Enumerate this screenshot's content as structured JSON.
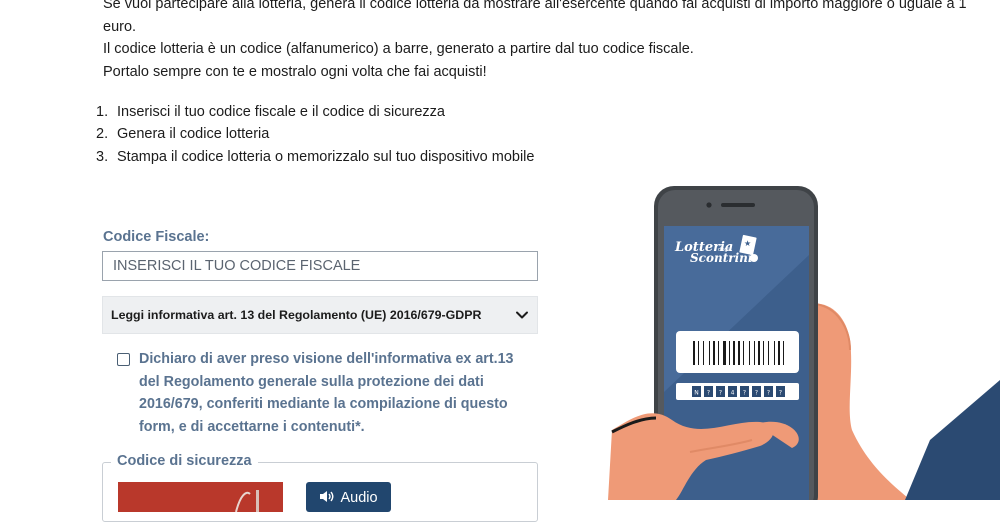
{
  "intro": {
    "line1": "Se vuoi partecipare alla lotteria, genera il codice lotteria da mostrare all'esercente quando fai acquisti di importo maggiore o uguale a 1 euro.",
    "line2": "Il codice lotteria è un codice (alfanumerico) a barre, generato a partire dal tuo codice fiscale.",
    "line3": "Portalo sempre con te e mostralo ogni volta che fai acquisti!"
  },
  "steps": [
    {
      "num": "1.",
      "text": "Inserisci il tuo codice fiscale e il codice di sicurezza"
    },
    {
      "num": "2.",
      "text": "Genera il codice lotteria"
    },
    {
      "num": "3.",
      "text": "Stampa il codice lotteria o memorizzalo sul tuo dispositivo mobile"
    }
  ],
  "form": {
    "cf_label": "Codice Fiscale:",
    "cf_placeholder": "INSERISCI IL TUO CODICE FISCALE",
    "cf_value": "",
    "accordion_label": "Leggi informativa art. 13 del Regolamento (UE) 2016/679-GDPR",
    "consent_text": "Dichiaro di aver preso visione dell'informativa ex art.13 del Regolamento generale sulla protezione dei dati 2016/679, conferiti mediante la compilazione di questo form, e di accettarne i contenuti*.",
    "consent_checked": false,
    "security_legend": "Codice di sicurezza",
    "audio_label": "Audio"
  },
  "illustration": {
    "logo_line1": "Lotteria",
    "logo_small": "degli",
    "logo_line2": "Scontrini",
    "code_chars": [
      "N",
      "?",
      "?",
      "4",
      "?",
      "?",
      "?",
      "?"
    ]
  },
  "colors": {
    "label": "#5a7390",
    "accent_button": "#21466e",
    "phone_screen": "#3d5f8c",
    "captcha_bg": "#b9382b"
  }
}
